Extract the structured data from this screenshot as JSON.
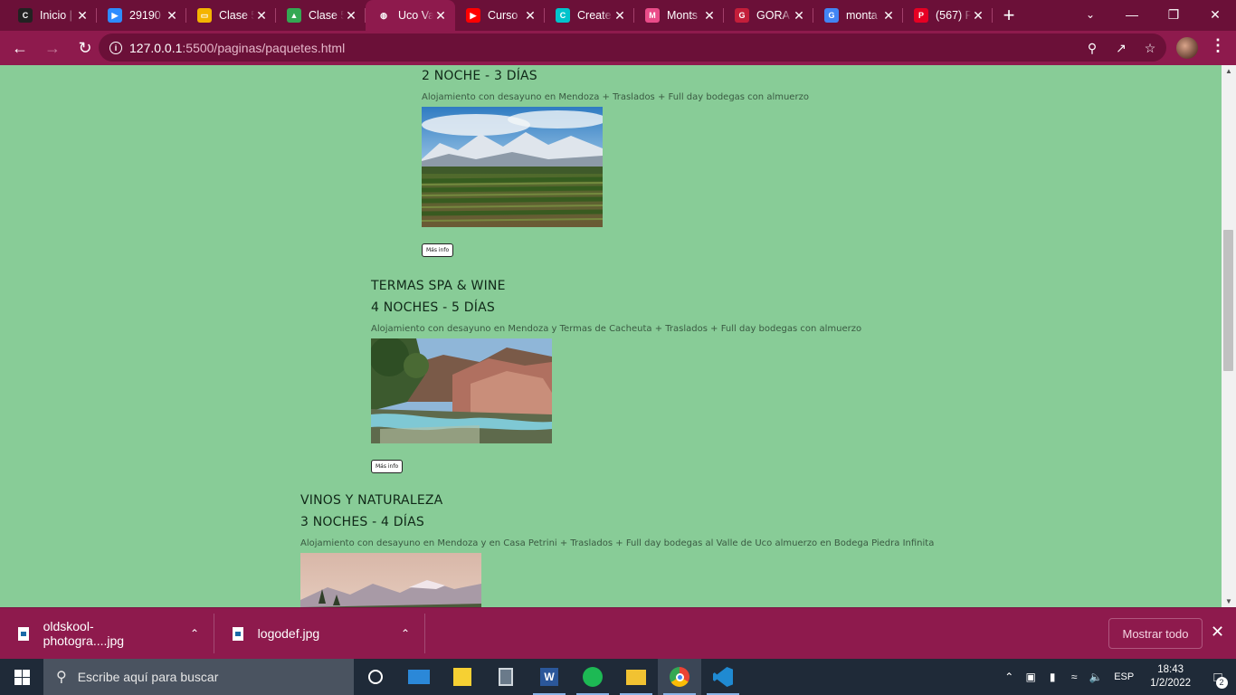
{
  "browser": {
    "tabs": [
      {
        "title": "Inicio |",
        "favicon": "coder-icon",
        "color": "#222222",
        "glyph": "C"
      },
      {
        "title": "29190",
        "favicon": "zoom-icon",
        "color": "#2d8cff",
        "glyph": "▶"
      },
      {
        "title": "Clase 5",
        "favicon": "slides-icon",
        "color": "#f4b400",
        "glyph": "▭"
      },
      {
        "title": "Clase 5",
        "favicon": "drive-icon",
        "color": "#34a853",
        "glyph": "▲"
      },
      {
        "title": "Uco Va",
        "favicon": "globe-icon",
        "color": "#ffffff",
        "glyph": "🌐",
        "active": true
      },
      {
        "title": "Curso",
        "favicon": "youtube-icon",
        "color": "#ff0000",
        "glyph": "▶"
      },
      {
        "title": "Create",
        "favicon": "canva-icon",
        "color": "#00c4cc",
        "glyph": "C"
      },
      {
        "title": "Monts",
        "favicon": "dribbble-icon",
        "color": "#ea4c89",
        "glyph": "M"
      },
      {
        "title": "GORA",
        "favicon": "gora-icon",
        "color": "#c41e3a",
        "glyph": "G"
      },
      {
        "title": "monta",
        "favicon": "google-icon",
        "color": "#4285f4",
        "glyph": "G"
      },
      {
        "title": "(567) F",
        "favicon": "pinterest-icon",
        "color": "#e60023",
        "glyph": "P"
      }
    ],
    "new_tab": "+",
    "url_host": "127.0.0.1",
    "url_path": ":5500/paginas/paquetes.html"
  },
  "packages": [
    {
      "name": "",
      "duration": "2 NOCHE - 3 DÍAS",
      "description": "Alojamiento con desayuno en Mendoza + Traslados + Full day bodegas con almuerzo",
      "button": "Más info"
    },
    {
      "name": "TERMAS SPA & WINE",
      "duration": "4 NOCHES - 5 DÍAS",
      "description": "Alojamiento con desayuno en Mendoza y Termas de Cacheuta + Traslados + Full day bodegas con almuerzo",
      "button": "Más info"
    },
    {
      "name": "VINOS Y NATURALEZA",
      "duration": "3 NOCHES - 4 DÍAS",
      "description": "Alojamiento con desayuno en Mendoza y en Casa Petrini + Traslados + Full day bodegas al Valle de Uco almuerzo en Bodega Piedra Infinita",
      "button": ""
    }
  ],
  "downloads": {
    "items": [
      {
        "filename": "oldskool-photogra....jpg"
      },
      {
        "filename": "logodef.jpg"
      }
    ],
    "show_all": "Mostrar todo"
  },
  "taskbar": {
    "search_placeholder": "Escribe aquí para buscar",
    "language": "ESP",
    "time": "18:43",
    "date": "1/2/2022",
    "notifications": "2"
  }
}
